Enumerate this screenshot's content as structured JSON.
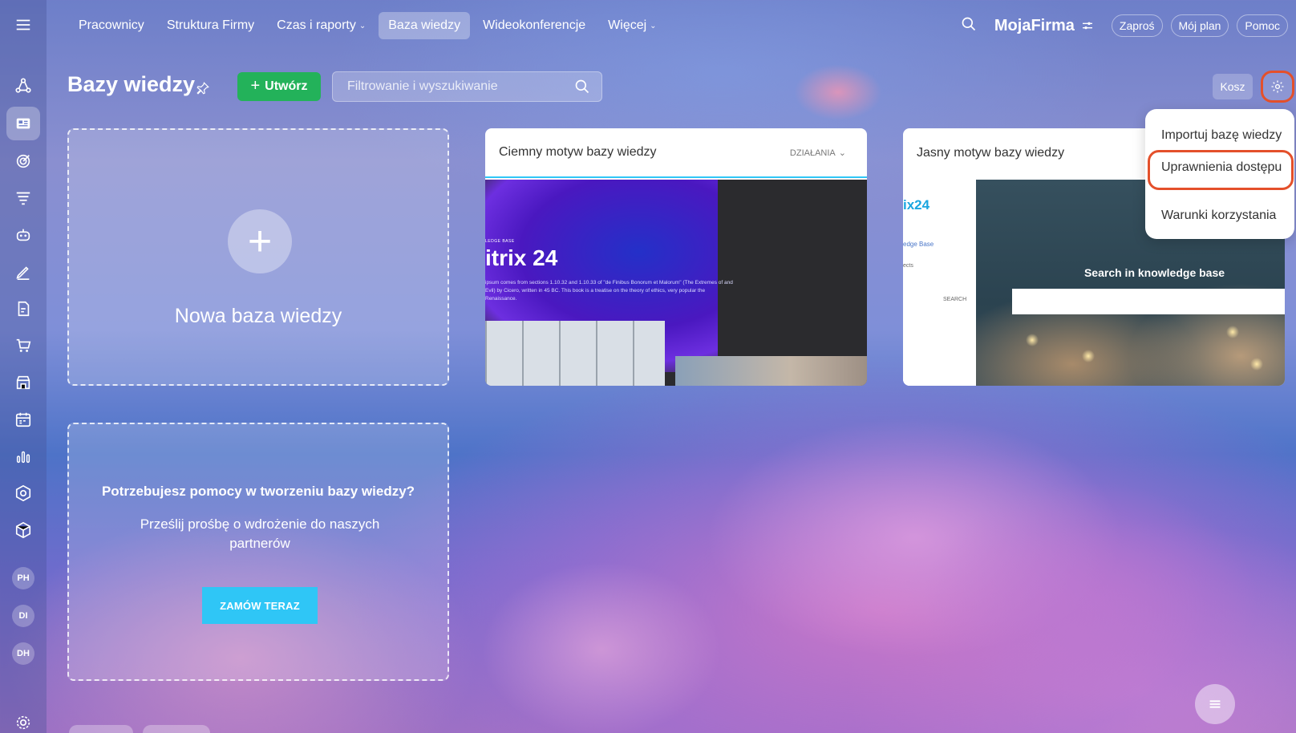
{
  "topnav": {
    "items": [
      {
        "label": "Pracownicy",
        "dropdown": false,
        "active": false
      },
      {
        "label": "Struktura Firmy",
        "dropdown": false,
        "active": false
      },
      {
        "label": "Czas i raporty",
        "dropdown": true,
        "active": false
      },
      {
        "label": "Baza wiedzy",
        "dropdown": false,
        "active": true
      },
      {
        "label": "Wideokonferencje",
        "dropdown": false,
        "active": false
      },
      {
        "label": "Więcej",
        "dropdown": true,
        "active": false
      }
    ],
    "brand": "MojaFirma",
    "invite_label": "Zaproś",
    "plan_label": "Mój plan",
    "help_label": "Pomoc"
  },
  "sidebar": {
    "icons": [
      "crm-icon",
      "feed-icon",
      "target-icon",
      "filter-icon",
      "robot-icon",
      "pen-icon",
      "document-sign-icon",
      "cart-icon",
      "store-icon",
      "calendar-icon",
      "chart-icon",
      "hexagon-icon",
      "cube-icon"
    ],
    "avatars": [
      "PH",
      "DI",
      "DH"
    ]
  },
  "header": {
    "title": "Bazy wiedzy",
    "create_label": "Utwórz",
    "search_placeholder": "Filtrowanie i wyszukiwanie",
    "trash_label": "Kosz"
  },
  "cards": {
    "new_kb_label": "Nowa baza wiedzy",
    "help_title": "Potrzebujesz pomocy w tworzeniu bazy wiedzy?",
    "help_text": "Prześlij prośbę o wdrożenie do naszych partnerów",
    "order_label": "ZAMÓW TERAZ",
    "dark_theme_title": "Ciemny motyw bazy wiedzy",
    "actions_label": "DZIAŁANIA",
    "dark_preview": {
      "small_label": "LEDGE BASE",
      "title": "itrix 24",
      "description": "ipsum comes from sections 1.10.32 and 1.10.33 of \"de Finibus Bonorum et Malorum\" (The Extremes of and Evil) by Cicero, written in 45 BC. This book is a treatise on the theory of ethics, very popular the Renaissance."
    },
    "light_theme_title": "Jasny motyw bazy wiedzy",
    "light_preview": {
      "logo": "ix24",
      "link": "edge Base",
      "sub": "ects",
      "search_small": "SEARCH",
      "hero_title": "Search in knowledge base"
    }
  },
  "menu": {
    "items": [
      "Importuj bazę wiedzy",
      "Uprawnienia dostępu",
      "Warunki korzystania"
    ],
    "highlighted_index": 1
  },
  "colors": {
    "create": "#23b25a",
    "order": "#2fc6f6",
    "highlight": "#e4502b"
  }
}
